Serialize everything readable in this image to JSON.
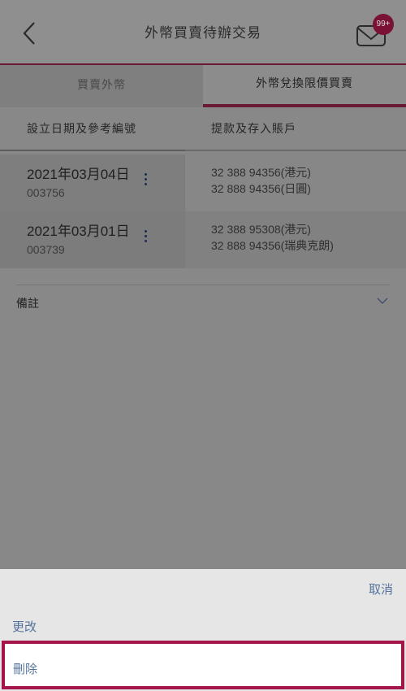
{
  "header": {
    "title": "外幣買賣待辦交易",
    "badge": "99+"
  },
  "tabs": [
    {
      "label": "買賣外幣",
      "active": false
    },
    {
      "label": "外幣兌換限價買賣",
      "active": true
    }
  ],
  "columns": {
    "left": "設立日期及參考編號",
    "right": "提款及存入賬戶"
  },
  "rows": [
    {
      "date": "2021年03月04日",
      "ref": "003756",
      "from": "32 388 94356(港元)",
      "to": "32 888 94356(日圓)"
    },
    {
      "date": "2021年03月01日",
      "ref": "003739",
      "from": "32 388 95308(港元)",
      "to": "32 888 94356(瑞典克朗)"
    }
  ],
  "remark": {
    "label": "備註"
  },
  "action_sheet": {
    "cancel": "取消",
    "edit": "更改",
    "delete": "刪除"
  },
  "colors": {
    "brand": "#a3144a",
    "link": "#56739c",
    "badge": "#7a1236"
  },
  "icons": [
    "back-arrow-icon",
    "envelope-icon",
    "more-vertical-icon",
    "chevron-down-icon"
  ]
}
